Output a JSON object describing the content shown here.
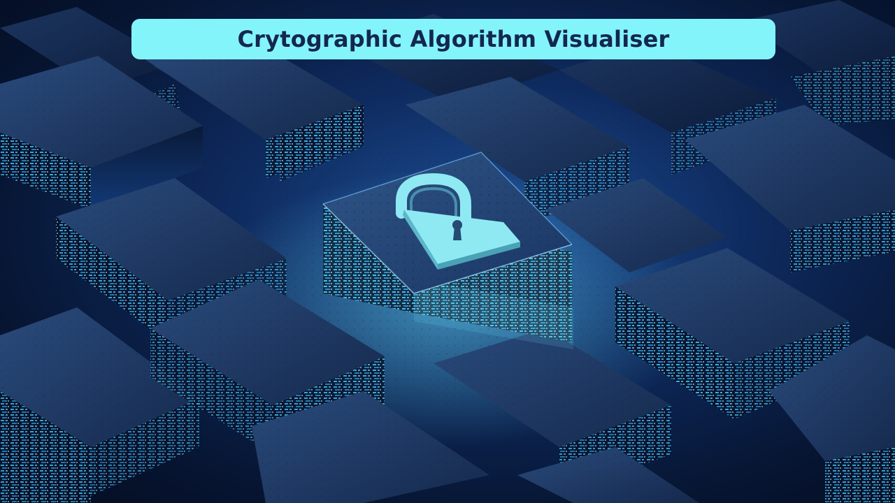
{
  "header": {
    "title": "Crytographic Algorithm Visualiser"
  },
  "hero": {
    "image_subject": "glowing padlock chip on circuit tile grid",
    "icon": "lock-icon"
  },
  "colors": {
    "banner_bg": "#84f4fb",
    "title_text": "#14274e",
    "background_dark": "#06122b",
    "tile_top": "#1f3a63",
    "glow": "#4fd9ff",
    "lock": "#8fe9f2"
  }
}
